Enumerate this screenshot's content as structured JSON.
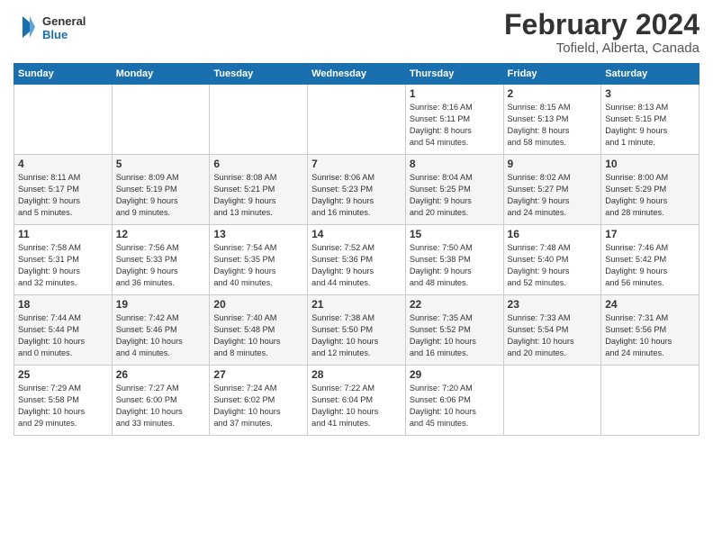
{
  "app": {
    "name": "GeneralBlue",
    "logo_line1": "General",
    "logo_line2": "Blue"
  },
  "header": {
    "month": "February 2024",
    "location": "Tofield, Alberta, Canada"
  },
  "days_of_week": [
    "Sunday",
    "Monday",
    "Tuesday",
    "Wednesday",
    "Thursday",
    "Friday",
    "Saturday"
  ],
  "weeks": [
    [
      {
        "day": "",
        "info": ""
      },
      {
        "day": "",
        "info": ""
      },
      {
        "day": "",
        "info": ""
      },
      {
        "day": "",
        "info": ""
      },
      {
        "day": "1",
        "info": "Sunrise: 8:16 AM\nSunset: 5:11 PM\nDaylight: 8 hours\nand 54 minutes."
      },
      {
        "day": "2",
        "info": "Sunrise: 8:15 AM\nSunset: 5:13 PM\nDaylight: 8 hours\nand 58 minutes."
      },
      {
        "day": "3",
        "info": "Sunrise: 8:13 AM\nSunset: 5:15 PM\nDaylight: 9 hours\nand 1 minute."
      }
    ],
    [
      {
        "day": "4",
        "info": "Sunrise: 8:11 AM\nSunset: 5:17 PM\nDaylight: 9 hours\nand 5 minutes."
      },
      {
        "day": "5",
        "info": "Sunrise: 8:09 AM\nSunset: 5:19 PM\nDaylight: 9 hours\nand 9 minutes."
      },
      {
        "day": "6",
        "info": "Sunrise: 8:08 AM\nSunset: 5:21 PM\nDaylight: 9 hours\nand 13 minutes."
      },
      {
        "day": "7",
        "info": "Sunrise: 8:06 AM\nSunset: 5:23 PM\nDaylight: 9 hours\nand 16 minutes."
      },
      {
        "day": "8",
        "info": "Sunrise: 8:04 AM\nSunset: 5:25 PM\nDaylight: 9 hours\nand 20 minutes."
      },
      {
        "day": "9",
        "info": "Sunrise: 8:02 AM\nSunset: 5:27 PM\nDaylight: 9 hours\nand 24 minutes."
      },
      {
        "day": "10",
        "info": "Sunrise: 8:00 AM\nSunset: 5:29 PM\nDaylight: 9 hours\nand 28 minutes."
      }
    ],
    [
      {
        "day": "11",
        "info": "Sunrise: 7:58 AM\nSunset: 5:31 PM\nDaylight: 9 hours\nand 32 minutes."
      },
      {
        "day": "12",
        "info": "Sunrise: 7:56 AM\nSunset: 5:33 PM\nDaylight: 9 hours\nand 36 minutes."
      },
      {
        "day": "13",
        "info": "Sunrise: 7:54 AM\nSunset: 5:35 PM\nDaylight: 9 hours\nand 40 minutes."
      },
      {
        "day": "14",
        "info": "Sunrise: 7:52 AM\nSunset: 5:36 PM\nDaylight: 9 hours\nand 44 minutes."
      },
      {
        "day": "15",
        "info": "Sunrise: 7:50 AM\nSunset: 5:38 PM\nDaylight: 9 hours\nand 48 minutes."
      },
      {
        "day": "16",
        "info": "Sunrise: 7:48 AM\nSunset: 5:40 PM\nDaylight: 9 hours\nand 52 minutes."
      },
      {
        "day": "17",
        "info": "Sunrise: 7:46 AM\nSunset: 5:42 PM\nDaylight: 9 hours\nand 56 minutes."
      }
    ],
    [
      {
        "day": "18",
        "info": "Sunrise: 7:44 AM\nSunset: 5:44 PM\nDaylight: 10 hours\nand 0 minutes."
      },
      {
        "day": "19",
        "info": "Sunrise: 7:42 AM\nSunset: 5:46 PM\nDaylight: 10 hours\nand 4 minutes."
      },
      {
        "day": "20",
        "info": "Sunrise: 7:40 AM\nSunset: 5:48 PM\nDaylight: 10 hours\nand 8 minutes."
      },
      {
        "day": "21",
        "info": "Sunrise: 7:38 AM\nSunset: 5:50 PM\nDaylight: 10 hours\nand 12 minutes."
      },
      {
        "day": "22",
        "info": "Sunrise: 7:35 AM\nSunset: 5:52 PM\nDaylight: 10 hours\nand 16 minutes."
      },
      {
        "day": "23",
        "info": "Sunrise: 7:33 AM\nSunset: 5:54 PM\nDaylight: 10 hours\nand 20 minutes."
      },
      {
        "day": "24",
        "info": "Sunrise: 7:31 AM\nSunset: 5:56 PM\nDaylight: 10 hours\nand 24 minutes."
      }
    ],
    [
      {
        "day": "25",
        "info": "Sunrise: 7:29 AM\nSunset: 5:58 PM\nDaylight: 10 hours\nand 29 minutes."
      },
      {
        "day": "26",
        "info": "Sunrise: 7:27 AM\nSunset: 6:00 PM\nDaylight: 10 hours\nand 33 minutes."
      },
      {
        "day": "27",
        "info": "Sunrise: 7:24 AM\nSunset: 6:02 PM\nDaylight: 10 hours\nand 37 minutes."
      },
      {
        "day": "28",
        "info": "Sunrise: 7:22 AM\nSunset: 6:04 PM\nDaylight: 10 hours\nand 41 minutes."
      },
      {
        "day": "29",
        "info": "Sunrise: 7:20 AM\nSunset: 6:06 PM\nDaylight: 10 hours\nand 45 minutes."
      },
      {
        "day": "",
        "info": ""
      },
      {
        "day": "",
        "info": ""
      }
    ]
  ]
}
